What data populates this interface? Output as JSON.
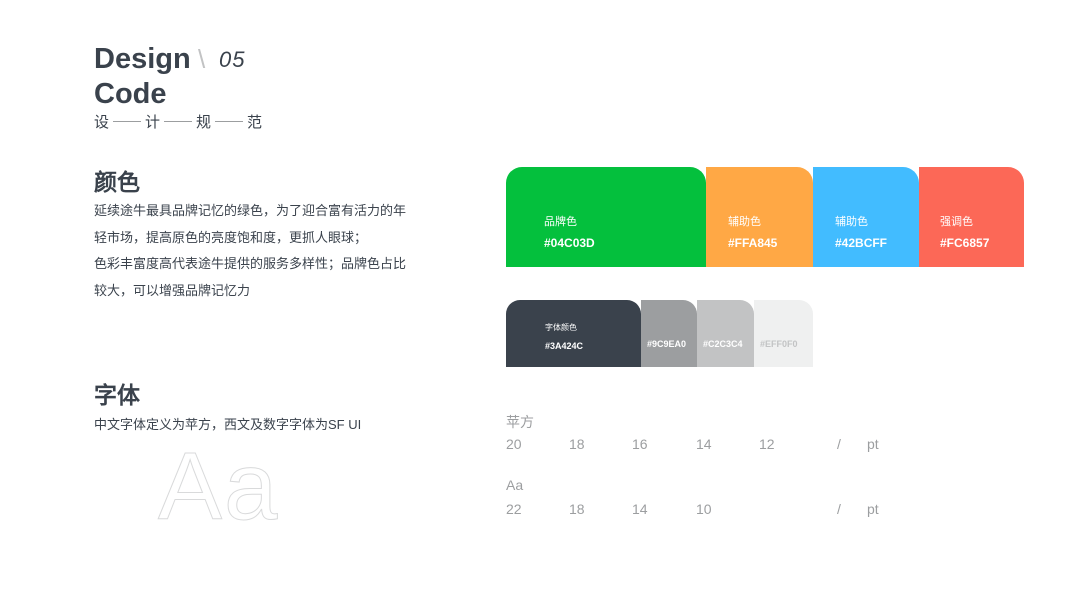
{
  "header": {
    "line1": "Design",
    "line2": "Code",
    "number": "05",
    "slash": "\\",
    "subtitle_chars": [
      "设",
      "计",
      "规",
      "范"
    ]
  },
  "color_section": {
    "title": "颜色",
    "paragraph_lines": [
      "延续途牛最具品牌记忆的绿色，为了迎合富有活力的年",
      "轻市场，提高原色的亮度饱和度，更抓人眼球；",
      "色彩丰富度高代表途牛提供的服务多样性；品牌色占比",
      "较大，可以增强品牌记忆力"
    ],
    "main_swatches": [
      {
        "label": "品牌色",
        "hex": "#04C03D",
        "color": "#04C03D"
      },
      {
        "label": "辅助色",
        "hex": "#FFA845",
        "color": "#FFA845"
      },
      {
        "label": "辅助色",
        "hex": "#42BCFF",
        "color": "#42BCFF"
      },
      {
        "label": "强调色",
        "hex": "#FC6857",
        "color": "#FC6857"
      }
    ],
    "gray_swatches": [
      {
        "label": "字体颜色",
        "hex": "#3A424C",
        "color": "#3A424C",
        "text_color": "#FFFFFF"
      },
      {
        "label": "",
        "hex": "#9C9EA0",
        "color": "#9C9EA0",
        "text_color": "#FFFFFF"
      },
      {
        "label": "",
        "hex": "#C2C3C4",
        "color": "#C2C3C4",
        "text_color": "#FFFFFF"
      },
      {
        "label": "",
        "hex": "#EFF0F0",
        "color": "#EFF0F0",
        "text_color": "#C2C3C4"
      }
    ]
  },
  "font_section": {
    "title": "字体",
    "description": "中文字体定义为苹方，西文及数字字体为SF UI",
    "sample": "Aa",
    "rows": [
      {
        "name": "苹方",
        "sizes": [
          "20",
          "18",
          "16",
          "14",
          "12"
        ],
        "slash": "/",
        "unit": "pt"
      },
      {
        "name": "Aa",
        "sizes": [
          "22",
          "18",
          "14",
          "10",
          ""
        ],
        "slash": "/",
        "unit": "pt"
      }
    ]
  }
}
